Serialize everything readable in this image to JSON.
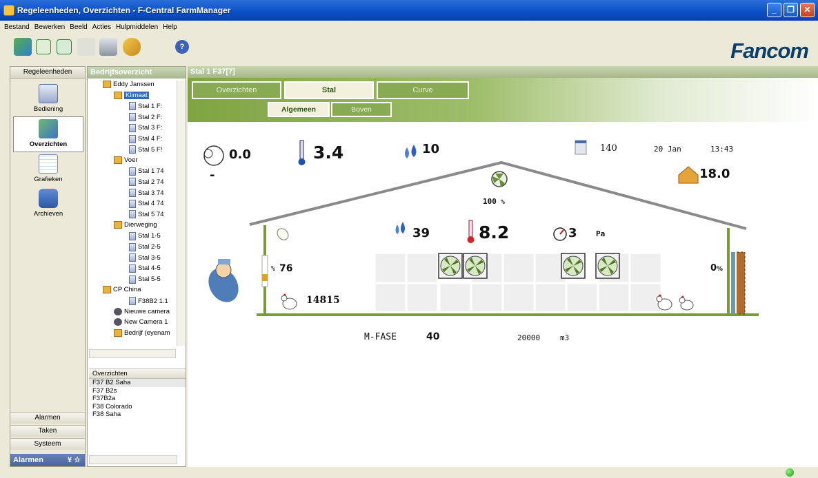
{
  "window": {
    "title": "Regeleenheden, Overzichten - F-Central FarmManager"
  },
  "menu": [
    "Bestand",
    "Bewerken",
    "Beeld",
    "Acties",
    "Hulpmiddelen",
    "Help"
  ],
  "brand": {
    "logo_text": "Fancom",
    "color": "#0b3f6a"
  },
  "nav": {
    "header": "Regeleenheden",
    "items": [
      "Bediening",
      "Overzichten",
      "Grafieken",
      "Archieven"
    ],
    "selected": "Overzichten",
    "bottom": [
      "Alarmen",
      "Taken",
      "Systeem"
    ],
    "alarm_bar": "Alarmen"
  },
  "tree": {
    "header": "Bedrijfsoverzicht",
    "nodes": [
      "Eddy Janssen",
      "Klimaat",
      "Stal 1 F:",
      "Stal 2 F:",
      "Stal 3 F:",
      "Stal 4 F:",
      "Stal 5 F!",
      "Voer",
      "Stal 1 74",
      "Stal 2 74",
      "Stal 3 74",
      "Stal 4 74",
      "Stal 5 74",
      "Dierweging",
      "Stal 1-5",
      "Stal 2-5",
      "Stal 3-5",
      "Stal 4-5",
      "Stal 5-5",
      "CP China",
      "F38B2 1.1",
      "Nieuwe camera",
      "New Camera 1",
      "Bedrijf (eyenam"
    ],
    "selected": "Klimaat"
  },
  "overview_list": {
    "header": "Overzichten",
    "items": [
      "F37 B2 Saha",
      "F37 B2s",
      "F37B2a",
      "F38 Colorado",
      "F38 Saha"
    ]
  },
  "main": {
    "header": "Stal 1 F37[7]",
    "tabs": [
      "Overzichten",
      "Stal",
      "Curve"
    ],
    "active_tab": "Stal",
    "subtabs": [
      "Algemeen",
      "Boven"
    ],
    "active_subtab": "Algemeen"
  },
  "stal": {
    "outside_rh": "0.0",
    "outside_dash": "-",
    "outside_temp": "3.4",
    "humidity": "10",
    "counter": "140",
    "date": "20 Jan",
    "time": "13:43",
    "house_temp": "18.0",
    "roof_fan_pct": "100",
    "roof_fan_unit": "%",
    "inside_rh": "39",
    "inside_temp": "8.2",
    "pressure": "3",
    "pressure_unit": "Pa",
    "inlet_unit": "%",
    "inlet_pct": "76",
    "animals": "14815",
    "right_inlet": "0",
    "right_inlet_unit": "%",
    "phase_label": "M-FASE",
    "phase_value": "40",
    "volume": "20000",
    "volume_unit": "m3"
  },
  "colors": {
    "green": "#88aa52",
    "wall": "#7a9a3a",
    "roof": "#888888"
  }
}
